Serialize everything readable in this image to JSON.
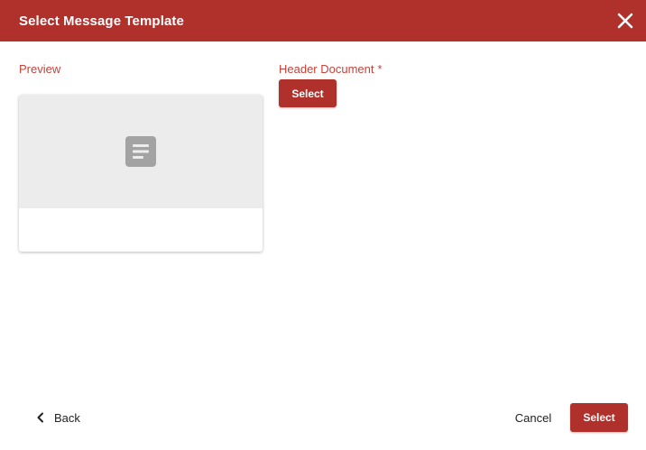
{
  "dialog": {
    "title": "Select Message Template"
  },
  "preview": {
    "label": "Preview",
    "placeholder_icon": "document-icon"
  },
  "header_document": {
    "label": "Header Document",
    "required_marker": "*",
    "select_label": "Select"
  },
  "footer": {
    "back_label": "Back",
    "cancel_label": "Cancel",
    "select_label": "Select"
  },
  "colors": {
    "brand": "#b0302c",
    "label": "#c5423a",
    "preview_bg": "#ececec",
    "icon": "#a3a3a3"
  }
}
